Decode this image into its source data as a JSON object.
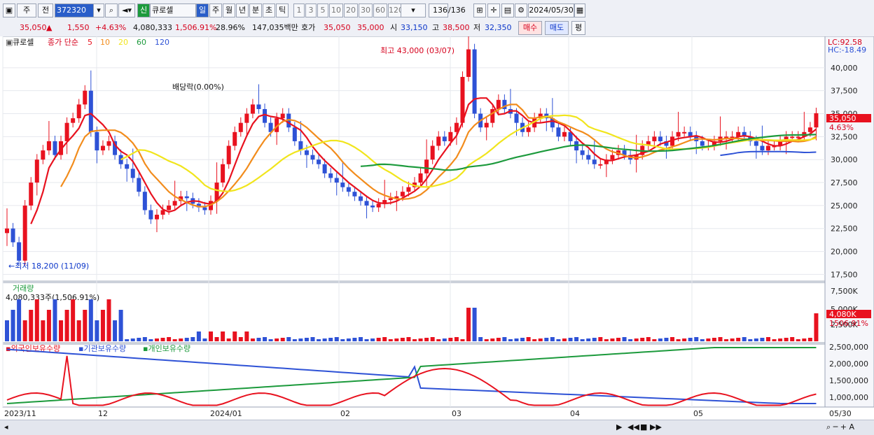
{
  "toolbar": {
    "period_label": "주",
    "prev_label": "전",
    "code": "372320",
    "tag": "신",
    "name": "큐로셀",
    "tabs": [
      "일",
      "주",
      "월",
      "년",
      "분",
      "초",
      "틱"
    ],
    "intervals": [
      "1",
      "3",
      "5",
      "10",
      "20",
      "30",
      "60",
      "120"
    ],
    "count": "136",
    "count_total": "/136",
    "date": "2024/05/30"
  },
  "quote": {
    "price": "35,050",
    "arrow": "▲",
    "change": "1,550",
    "pct": "+4.63%",
    "volume": "4,080,333",
    "vol_pct": "1,506.91%",
    "turnover": "28.96%",
    "amount": "147,035백만",
    "bid_label": "호가",
    "bid1": "35,050",
    "bid2": "35,000",
    "open_label": "시",
    "open": "33,150",
    "high_label": "고",
    "high": "38,500",
    "low_label": "저",
    "low": "32,350",
    "buy": "매수",
    "sell": "매도",
    "eval": "평"
  },
  "chart": {
    "legend_name": "큐로셀",
    "legend_ma": "종가 단순",
    "ma_periods": [
      "5",
      "10",
      "20",
      "60",
      "120"
    ],
    "ma_colors": [
      "#e8121f",
      "#f28c1c",
      "#f1e51d",
      "#1c9a3c",
      "#2e52d6"
    ],
    "lc": "LC:92.58",
    "hc": "HC:-18.49",
    "annot_high": "최고 43,000 (03/07)",
    "annot_low": "최저 18,200 (11/09)",
    "annot_div": "배당락(0.00%)",
    "price_ticks": [
      "40,000",
      "37,500",
      "35,000",
      "32,500",
      "30,000",
      "27,500",
      "25,000",
      "22,500",
      "20,000",
      "17,500"
    ],
    "price_tag": "35,050",
    "price_tag_pct": "4.63%",
    "vol_title": "거래량",
    "vol_info": "4,080,333주(1,506.91%)",
    "vol_ticks": [
      "7,500K",
      "5,000K",
      "2,500K"
    ],
    "vol_tag": "4,080K",
    "vol_tag_pct": "1506.91%",
    "holders": [
      "외국인보유수량",
      "기관보유수량",
      "개인보유수량"
    ],
    "holder_colors": [
      "#e8121f",
      "#2e52d6",
      "#1c9a3c"
    ],
    "holder_ticks": [
      "2,500,000",
      "2,000,000",
      "1,500,000",
      "1,000,000"
    ],
    "x_ticks": [
      "2023/11",
      "12",
      "2024/01",
      "02",
      "03",
      "04",
      "05",
      "05/30"
    ]
  },
  "chart_data": {
    "type": "candlestick",
    "x_axis": [
      "2023/11",
      "12",
      "2024/01",
      "02",
      "03",
      "04",
      "05"
    ],
    "ylim": [
      17000,
      42500
    ],
    "close_series": [
      22500,
      21000,
      19000,
      25000,
      27500,
      30000,
      31000,
      32000,
      30500,
      32000,
      34000,
      34500,
      36000,
      37500,
      33000,
      31000,
      31500,
      32000,
      30500,
      29500,
      29000,
      28000,
      26500,
      24500,
      23500,
      24000,
      24500,
      25000,
      25500,
      26000,
      25800,
      25200,
      24800,
      24500,
      25500,
      27500,
      29500,
      31500,
      33000,
      34000,
      35000,
      36000,
      35500,
      34000,
      33000,
      34500,
      35000,
      33500,
      32000,
      31000,
      30500,
      30000,
      29500,
      28500,
      28000,
      27500,
      27000,
      26500,
      26000,
      25500,
      25000,
      24800,
      25200,
      25600,
      25800,
      26000,
      26500,
      27000,
      27500,
      28500,
      30000,
      31500,
      32500,
      32000,
      33000,
      34000,
      39000,
      42000,
      35000,
      33500,
      34000,
      35500,
      36500,
      35500,
      35000,
      34000,
      33000,
      33500,
      34500,
      35000,
      34500,
      33500,
      32500,
      33000,
      32000,
      31000,
      30500,
      30000,
      29500,
      29500,
      30000,
      30500,
      31000,
      30500,
      30000,
      30500,
      31500,
      32000,
      32500,
      32000,
      31500,
      32500,
      33000,
      33000,
      32500,
      32000,
      31500,
      31500,
      32000,
      32500,
      32500,
      32500,
      33000,
      32500,
      32000,
      31500,
      31000,
      31500,
      31500,
      32000,
      32500,
      32500,
      32500,
      33000,
      33500,
      35050
    ],
    "holders_series": [
      {
        "name": "외국인보유수량",
        "trend": "spike near 2023/11 and 03, then decline to ~1,000,000"
      },
      {
        "name": "기관보유수량",
        "trend": "decline from ~2,500,000 to ~1,000,000"
      },
      {
        "name": "개인보유수량",
        "trend": "rise from ~1,000,000 to ~2,500,000"
      }
    ]
  }
}
